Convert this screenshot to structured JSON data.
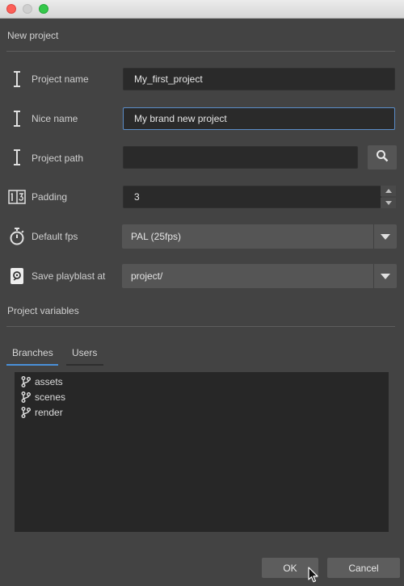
{
  "window": {
    "controls": [
      "close",
      "minimize",
      "zoom"
    ]
  },
  "header": {
    "title": "New project"
  },
  "form": {
    "project_name": {
      "label": "Project name",
      "value": "My_first_project",
      "icon": "text-cursor-icon"
    },
    "nice_name": {
      "label": "Nice name",
      "value": "My brand new project",
      "icon": "text-cursor-icon"
    },
    "project_path": {
      "label": "Project path",
      "value": "",
      "icon": "text-cursor-icon",
      "button_icon": "search-icon"
    },
    "padding": {
      "label": "Padding",
      "value": "3",
      "icon": "number-padding-icon"
    },
    "default_fps": {
      "label": "Default fps",
      "value": "PAL (25fps)",
      "icon": "stopwatch-icon"
    },
    "save_playblast": {
      "label": "Save playblast at",
      "value": "project/",
      "icon": "disk-icon"
    }
  },
  "variables": {
    "title": "Project variables",
    "tabs": [
      {
        "label": "Branches",
        "active": true
      },
      {
        "label": "Users",
        "active": false
      }
    ],
    "branches": [
      "assets",
      "scenes",
      "render"
    ]
  },
  "buttons": {
    "ok": "OK",
    "cancel": "Cancel"
  },
  "colors": {
    "accent": "#4a90d9",
    "background": "#434343",
    "field": "#2a2a2a"
  }
}
